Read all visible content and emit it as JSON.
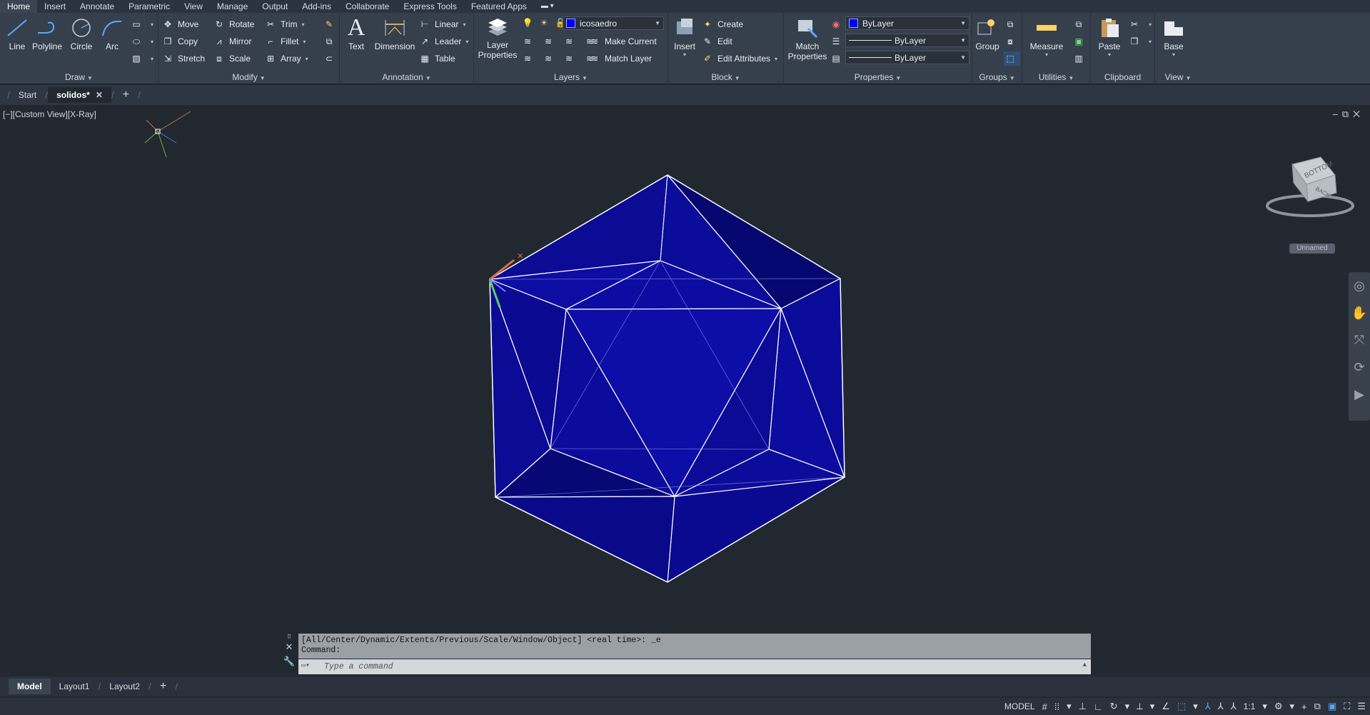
{
  "menu": {
    "items": [
      "Home",
      "Insert",
      "Annotate",
      "Parametric",
      "View",
      "Manage",
      "Output",
      "Add-ins",
      "Collaborate",
      "Express Tools",
      "Featured Apps"
    ]
  },
  "ribbon": {
    "draw": {
      "title": "Draw",
      "line": "Line",
      "polyline": "Polyline",
      "circle": "Circle",
      "arc": "Arc"
    },
    "modify": {
      "title": "Modify",
      "move": "Move",
      "rotate": "Rotate",
      "trim": "Trim",
      "copy": "Copy",
      "mirror": "Mirror",
      "fillet": "Fillet",
      "stretch": "Stretch",
      "scale": "Scale",
      "array": "Array"
    },
    "annotation": {
      "title": "Annotation",
      "text": "Text",
      "dimension": "Dimension",
      "linear": "Linear",
      "leader": "Leader",
      "table": "Table"
    },
    "layers": {
      "title": "Layers",
      "layer_properties_1": "Layer",
      "layer_properties_2": "Properties",
      "current_layer": "icosaedro",
      "make_current": "Make Current",
      "match_layer": "Match Layer"
    },
    "block": {
      "title": "Block",
      "insert": "Insert",
      "create": "Create",
      "edit": "Edit",
      "edit_attributes": "Edit Attributes"
    },
    "properties": {
      "title": "Properties",
      "match_1": "Match",
      "match_2": "Properties",
      "color": "ByLayer",
      "linetype": "ByLayer",
      "lineweight": "ByLayer"
    },
    "groups": {
      "title": "Groups",
      "group": "Group"
    },
    "utilities": {
      "title": "Utilities",
      "measure": "Measure"
    },
    "clipboard": {
      "title": "Clipboard",
      "paste": "Paste"
    },
    "view": {
      "title": "View",
      "base": "Base"
    }
  },
  "file_tabs": {
    "start": "Start",
    "current": "solidos*"
  },
  "viewport": {
    "label": "[−][Custom View][X-Ray]",
    "viewcube_face": "BOTTOM",
    "viewcube_side": "BACK",
    "ucs_name": "Unnamed"
  },
  "command": {
    "history_line1": "[All/Center/Dynamic/Extents/Previous/Scale/Window/Object] <real time>: _e",
    "history_line2": "Command:",
    "placeholder": "Type a command"
  },
  "layout_tabs": [
    "Model",
    "Layout1",
    "Layout2"
  ],
  "status": {
    "space": "MODEL",
    "scale": "1:1"
  },
  "colors": {
    "solid_fill": "#0a0a9e",
    "edge": "#ffffff",
    "background": "#212830"
  }
}
